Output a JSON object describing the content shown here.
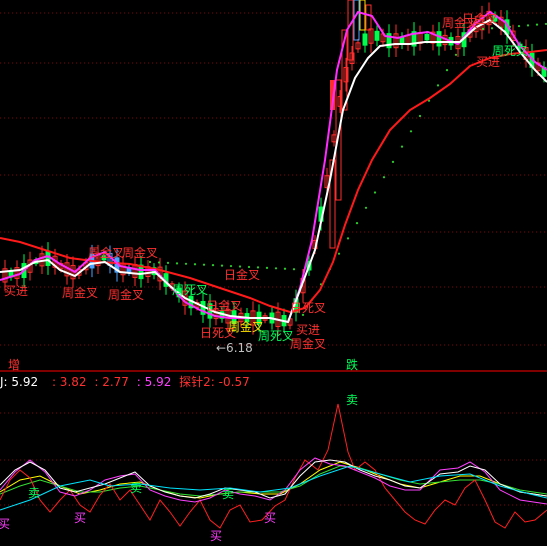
{
  "colors": {
    "background": "#000000",
    "grid": "#8b0000",
    "separator": "#ff0000",
    "up_candle": "#ff2e2e",
    "down_candle": "#00ff4c",
    "yellow_candle": "#ffe000",
    "blue_candle": "#4aa3ff",
    "ma_white": "#ffffff",
    "ma_magenta": "#ff2cff",
    "ma_red": "#ff1a1a",
    "dots": "#2bd12b",
    "signal_red": "#ff3030",
    "signal_green": "#00ff5a",
    "signal_magenta": "#ff3cff",
    "ind_white": "#ffffff",
    "ind_yellow": "#ffff00",
    "ind_magenta": "#ff40ff",
    "ind_red": "#ff2020",
    "ind_green": "#34e034",
    "ind_cyan": "#00e5ff"
  },
  "top_markers": {
    "left": "增",
    "right": "跌"
  },
  "low_price_annotation": "←6.18",
  "indicator_bar": {
    "j": "J: 5.92",
    "v1": ": 3.82",
    "v2": ": 2.77",
    "v3": ": 5.92",
    "probe": "探针2: -0.57"
  },
  "chart_data": {
    "type": "candlestick",
    "title": "",
    "xlabel": "",
    "ylabel": "",
    "grid": true,
    "price_annotations": [
      {
        "text": "←6.18",
        "value": 6.18
      }
    ],
    "signals_main": [
      {
        "text": "买进"
      },
      {
        "text": "周金叉"
      },
      {
        "text": "周金叉"
      },
      {
        "text": "周金叉"
      },
      {
        "text": "日金叉"
      },
      {
        "text": "周金叉"
      },
      {
        "text": "周死叉"
      },
      {
        "text": "日死叉"
      },
      {
        "text": "日金叉"
      },
      {
        "text": "周金叉"
      },
      {
        "text": "周死叉"
      },
      {
        "text": "日死叉"
      },
      {
        "text": "周金叉"
      },
      {
        "text": "买进"
      },
      {
        "text": "周金叉"
      },
      {
        "text": "日金叉"
      },
      {
        "text": "周死叉"
      },
      {
        "text": "买进"
      }
    ],
    "signals_sub": [
      {
        "text": "卖"
      },
      {
        "text": "卖"
      },
      {
        "text": "卖"
      },
      {
        "text": "卖"
      },
      {
        "text": "买"
      },
      {
        "text": "买"
      },
      {
        "text": "买"
      },
      {
        "text": "买"
      }
    ],
    "indicator_values": {
      "J": 5.92,
      "V1": 3.82,
      "V2": 2.77,
      "V3": 5.92,
      "探针2": -0.57
    }
  }
}
